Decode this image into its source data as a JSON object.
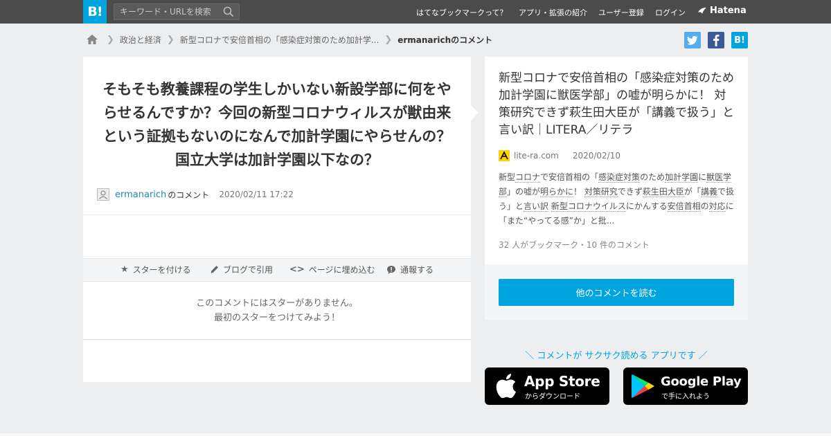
{
  "topbar": {
    "logo": "B!",
    "search_placeholder": "キーワード・URLを検索",
    "nav": [
      "はてなブックマークって？",
      "アプリ・拡張の紹介",
      "ユーザー登録",
      "ログイン"
    ],
    "hatena": "Hatena"
  },
  "breadcrumb": {
    "items": [
      "政治と経済",
      "新型コロナで安倍首相の「感染症対策のため加計学..."
    ],
    "current": "ermanarichのコメント"
  },
  "share": {
    "twitter": "t",
    "facebook": "f",
    "hatebu": "B!"
  },
  "comment": {
    "text": "そもそも教養課程の学生しかいない新設学部に何をやらせるんですか？今回の新型コロナウィルスが獣由来という証拠もないのになんで加計学園にやらせんの？国立大学は加計学園以下なの？",
    "user": "ermanarich",
    "user_suffix": "のコメント",
    "date": "2020/02/11 17:22"
  },
  "actions": [
    "スターを付ける",
    "ブログで引用",
    "ページに埋め込む",
    "通報する"
  ],
  "nostar": [
    "このコメントにはスターがありません。",
    "最初のスターをつけてみよう！"
  ],
  "entry": {
    "title": "新型コロナで安倍首相の「感染症対策のため加計学園に獣医学部」の嘘が明らかに！ 対策研究できず萩生田大臣が「講義で扱う」と言い訳｜LITERA／リテラ",
    "site": "lite-ra.com",
    "date": "2020/02/10",
    "summary": {
      "p1": "新型",
      "k1": "コロナ",
      "p2": "で安倍首相の「",
      "k2": "感染症対策",
      "p3": "のため",
      "k3": "加計学園",
      "p4": "に",
      "k4": "獣医学部",
      "p5": "」の嘘が",
      "k5": "明らかに",
      "p6": "！ ",
      "k6": "対策研究",
      "p7": "できず",
      "k7": "萩生田大臣",
      "p8": "が「",
      "k8": "講義",
      "p9": "で扱う」と",
      "k9": "言い訳",
      "p10": " ",
      "k10": "新型コロナウイルス",
      "p11": "にかんする",
      "k11": "安倍首相",
      "p12": "の",
      "k12": "対応",
      "p13": "に「また“やってる感”か」と批..."
    },
    "meta": "32 人がブックマーク・10 件のコメント",
    "read_more": "他のコメントを読む"
  },
  "promo": {
    "text": "＼ コメントが サクサク読める アプリです ／",
    "appstore_big": "App Store",
    "appstore_small": "からダウンロード",
    "googleplay_big": "Google Play",
    "googleplay_small": "で手に入れよう"
  },
  "colors": {
    "accent": "#00a4de",
    "topbar": "#4b4b4b",
    "twitter": "#55acee",
    "facebook": "#3b5998"
  }
}
